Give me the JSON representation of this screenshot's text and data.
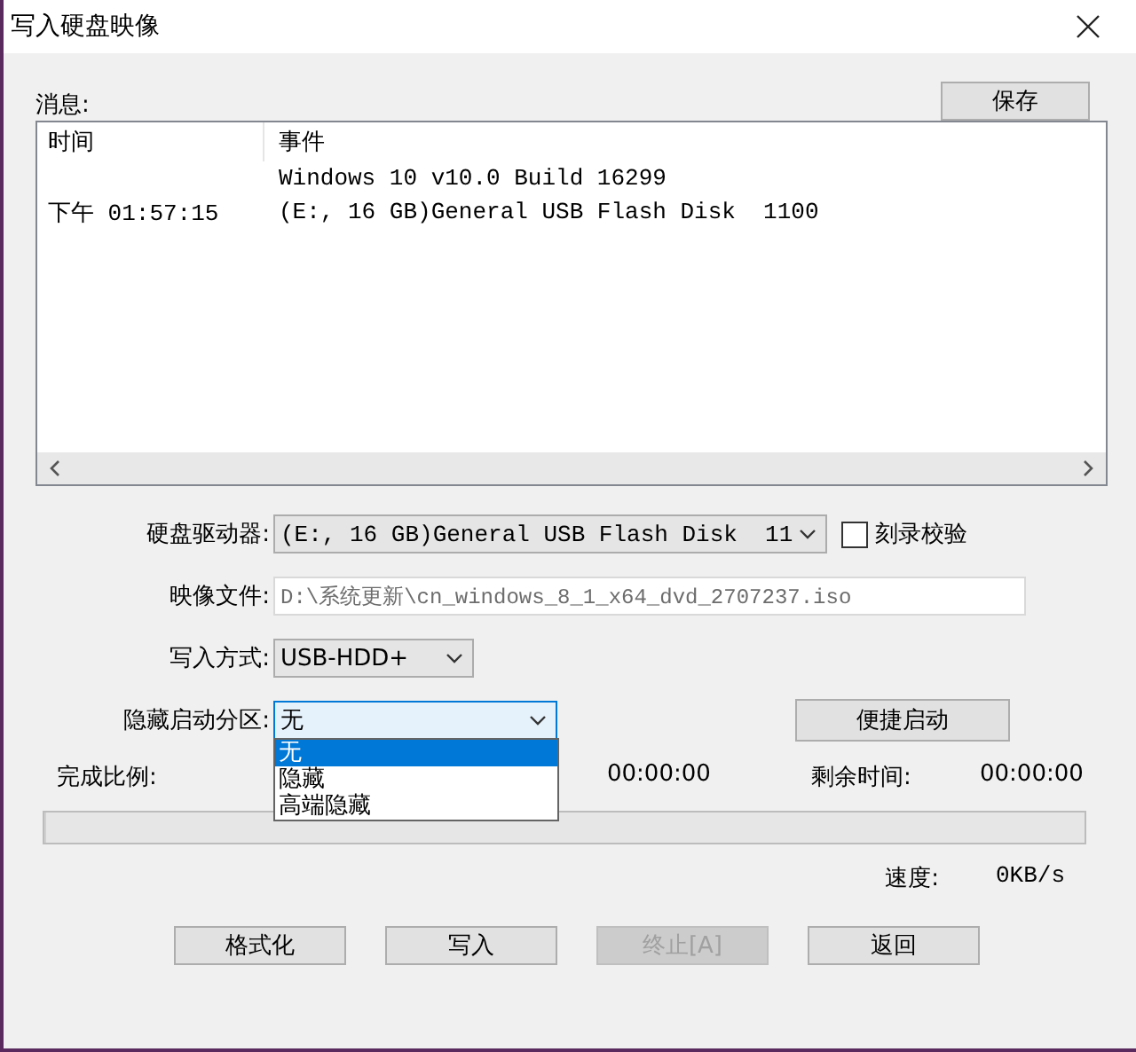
{
  "window": {
    "title": "写入硬盘映像"
  },
  "messages": {
    "label": "消息:",
    "save_button": "保存",
    "columns": [
      "时间",
      "事件"
    ],
    "rows": [
      {
        "event": "Windows 10 v10.0 Build 16299"
      },
      {
        "time": "下午 01:57:15",
        "event": "(E:, 16 GB)General USB Flash Disk  1100"
      }
    ]
  },
  "form": [
    {
      "kind": "combo",
      "label": "硬盘驱动器:",
      "value": "(E:, 16 GB)General USB Flash Disk  11",
      "checkbox": {
        "label": "刻录校验",
        "checked": false
      }
    },
    {
      "kind": "text",
      "label": "映像文件:",
      "value": "D:\\系统更新\\cn_windows_8_1_x64_dvd_2707237.iso",
      "disabled": true
    },
    {
      "kind": "combo",
      "label": "写入方式:",
      "value": "USB-HDD+"
    },
    {
      "kind": "combo",
      "label": "隐藏启动分区:",
      "value": "无",
      "expanded": true,
      "options": [
        {
          "label": "无",
          "selected": true
        },
        {
          "label": "隐藏",
          "selected": false
        },
        {
          "label": "高端隐藏",
          "selected": false
        }
      ],
      "button": "便捷启动"
    }
  ],
  "progress": {
    "completion_label": "完成比例:",
    "elapsed_value": "00:00:00",
    "remaining_label": "剩余时间:",
    "remaining_value": "00:00:00",
    "level": 0,
    "speed_label": "速度:",
    "speed_value": "0KB/s"
  },
  "buttons": [
    {
      "label": "格式化",
      "disabled": false
    },
    {
      "label": "写入",
      "disabled": false
    },
    {
      "label": "终止[A]",
      "disabled": true
    },
    {
      "label": "返回",
      "disabled": false
    }
  ]
}
